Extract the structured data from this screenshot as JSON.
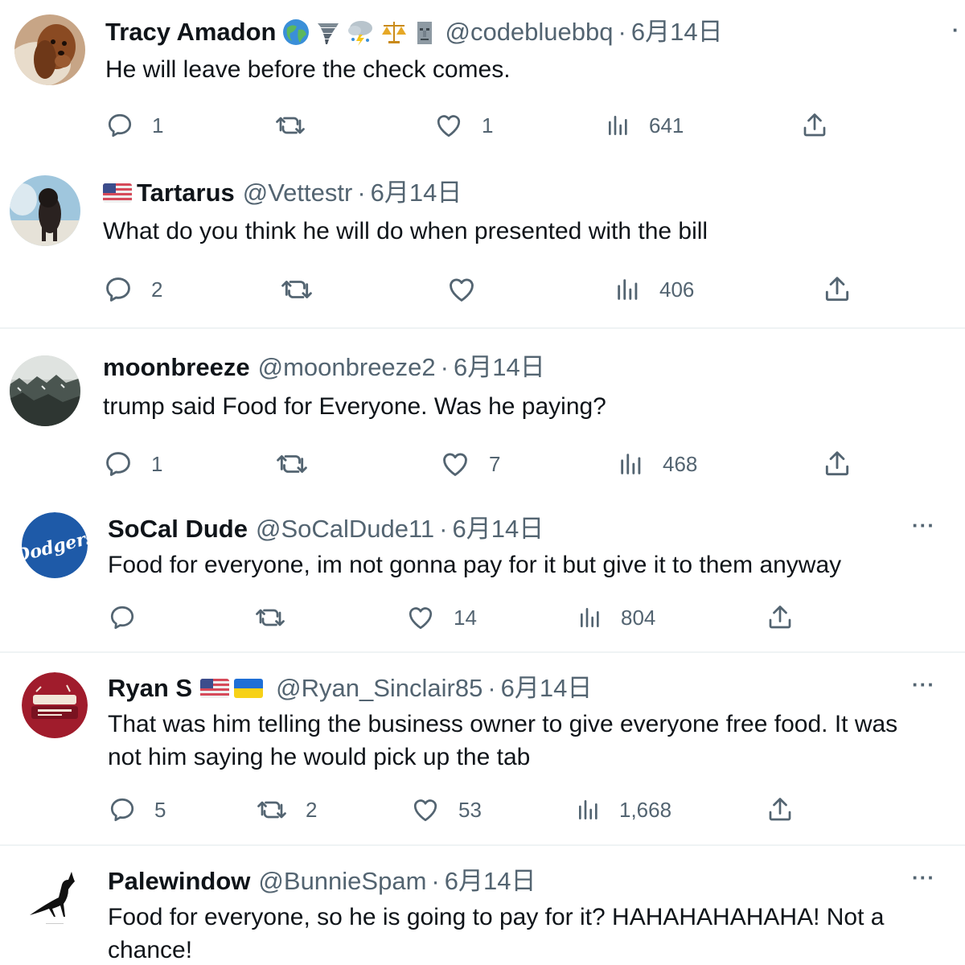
{
  "tweets": [
    {
      "name": "Tracy Amadon",
      "handle": "@codebluebbq",
      "date": "6月14日",
      "text": "He will leave before the check comes.",
      "emojis": [
        "globe-icon",
        "tornado-icon",
        "storm-cloud-icon",
        "scales-icon",
        "moai-icon"
      ],
      "counts": {
        "reply": "1",
        "retweet": "",
        "like": "1",
        "views": "641"
      },
      "avatar": "dachshund-photo"
    },
    {
      "name": "Tartarus",
      "handle": "@Vettestr",
      "date": "6月14日",
      "text": "What do you think he will do when presented with the bill",
      "flags": [
        "us-flag-icon"
      ],
      "counts": {
        "reply": "2",
        "retweet": "",
        "like": "",
        "views": "406"
      },
      "avatar": "dog-on-beach-photo"
    },
    {
      "name": "moonbreeze",
      "handle": "@moonbreeze2",
      "date": "6月14日",
      "text": "trump said Food for Everyone.  Was he paying?",
      "counts": {
        "reply": "1",
        "retweet": "",
        "like": "7",
        "views": "468"
      },
      "avatar": "landscape-photo"
    },
    {
      "name": "SoCal Dude",
      "handle": "@SoCalDude11",
      "date": "6月14日",
      "text": "Food for everyone, im not gonna pay for it but give it to them anyway",
      "counts": {
        "reply": "",
        "retweet": "",
        "like": "14",
        "views": "804"
      },
      "avatar": "dodgers-logo",
      "avatar_text": "Dodgers"
    },
    {
      "name": "Ryan S",
      "handle": "@Ryan_Sinclair85",
      "date": "6月14日",
      "text": "That was him telling the business owner to give everyone free food. It was",
      "text2": "not him saying he would pick up the tab",
      "flags": [
        "us-flag-icon",
        "ukraine-flag-icon"
      ],
      "counts": {
        "reply": "5",
        "retweet": "2",
        "like": "53",
        "views": "1,668"
      },
      "avatar": "restaurant-sign-logo"
    },
    {
      "name": "Palewindow",
      "handle": "@BunnieSpam",
      "date": "6月14日",
      "text": "Food for everyone, so he is going to pay for it?  HAHAHAHAHAHA!  Not a",
      "text2": "chance!",
      "avatar": "crow-silhouette"
    }
  ],
  "colors": {
    "text": "#0f1419",
    "muted": "#536471",
    "divider": "#eff3f4",
    "dodgers_blue": "#1e5aa8",
    "ryan_red": "#a01c2c"
  }
}
